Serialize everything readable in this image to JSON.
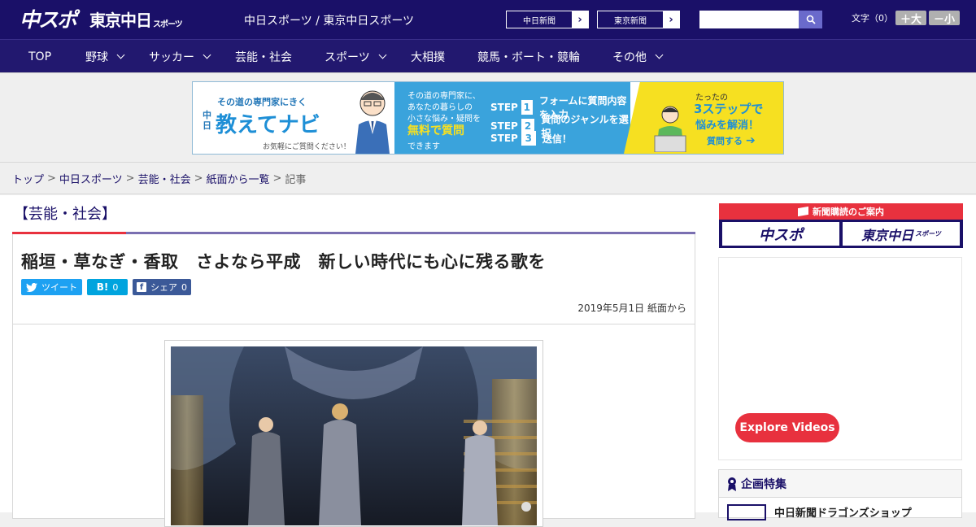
{
  "header": {
    "logo_main": "中スポ",
    "logo_tokyo": "東京中日",
    "logo_tokyo_suffix": "スポーツ",
    "site_names": "中日スポーツ / 東京中日スポーツ",
    "paper_links": [
      "中日新聞",
      "東京新聞"
    ],
    "search_placeholder": "",
    "font_size_label": "文字（0）",
    "font_larger": "＋大",
    "font_smaller": "－小"
  },
  "nav": {
    "items": [
      {
        "label": "TOP",
        "dropdown": false
      },
      {
        "label": "野球",
        "dropdown": true
      },
      {
        "label": "サッカー",
        "dropdown": true
      },
      {
        "label": "芸能・社会",
        "dropdown": false
      },
      {
        "label": "スポーツ",
        "dropdown": true
      },
      {
        "label": "大相撲",
        "dropdown": false
      },
      {
        "label": "競馬・ボート・競輪",
        "dropdown": false
      },
      {
        "label": "その他",
        "dropdown": true
      }
    ]
  },
  "banner": {
    "tagline": "その道の専門家にきく",
    "brand_small": "中日",
    "brand": "教えてナビ",
    "note": "お気軽にご質問ください！",
    "mid_text": [
      "その道の専門家に、",
      "あなたの暮らしの",
      "小さな悩み・疑問を"
    ],
    "mid_highlight": "無料で質問",
    "mid_tail": "できます",
    "steps": [
      {
        "label": "STEP",
        "num": "1",
        "text": "フォームに質問内容を入力"
      },
      {
        "label": "STEP",
        "num": "2",
        "text": "質問のジャンルを選択"
      },
      {
        "label": "STEP",
        "num": "3",
        "text": "送信！"
      }
    ],
    "right_top": "たったの",
    "right_big": "3ステップで",
    "right_sub": "悩みを解消！",
    "right_btn": "質問する"
  },
  "breadcrumb": [
    "トップ",
    "中日スポーツ",
    "芸能・社会",
    "紙面から一覧",
    "記事"
  ],
  "article": {
    "category": "【芸能・社会】",
    "headline": "稲垣・草なぎ・香取　さよなら平成　新しい時代にも心に残る歌を",
    "share": {
      "tweet": "ツイート",
      "hatena_icon": "B!",
      "hatena_count": "0",
      "facebook": "シェア",
      "facebook_count": "0"
    },
    "date": "2019年5月1日 紙面から"
  },
  "sidebar": {
    "subscribe_title": "新聞購読のご案内",
    "subscribe_logos": [
      "中スポ",
      "東京中日"
    ],
    "subscribe_logo_suffix": "スポーツ",
    "explore_button": "Explore Videos",
    "special_title": "企画特集",
    "special_item": "中日新聞ドラゴンズショップ"
  },
  "colors": {
    "header_bg": "#1a1068",
    "accent_red": "#e8313e",
    "banner_blue": "#3aa3dc",
    "banner_yellow": "#f6e021"
  }
}
